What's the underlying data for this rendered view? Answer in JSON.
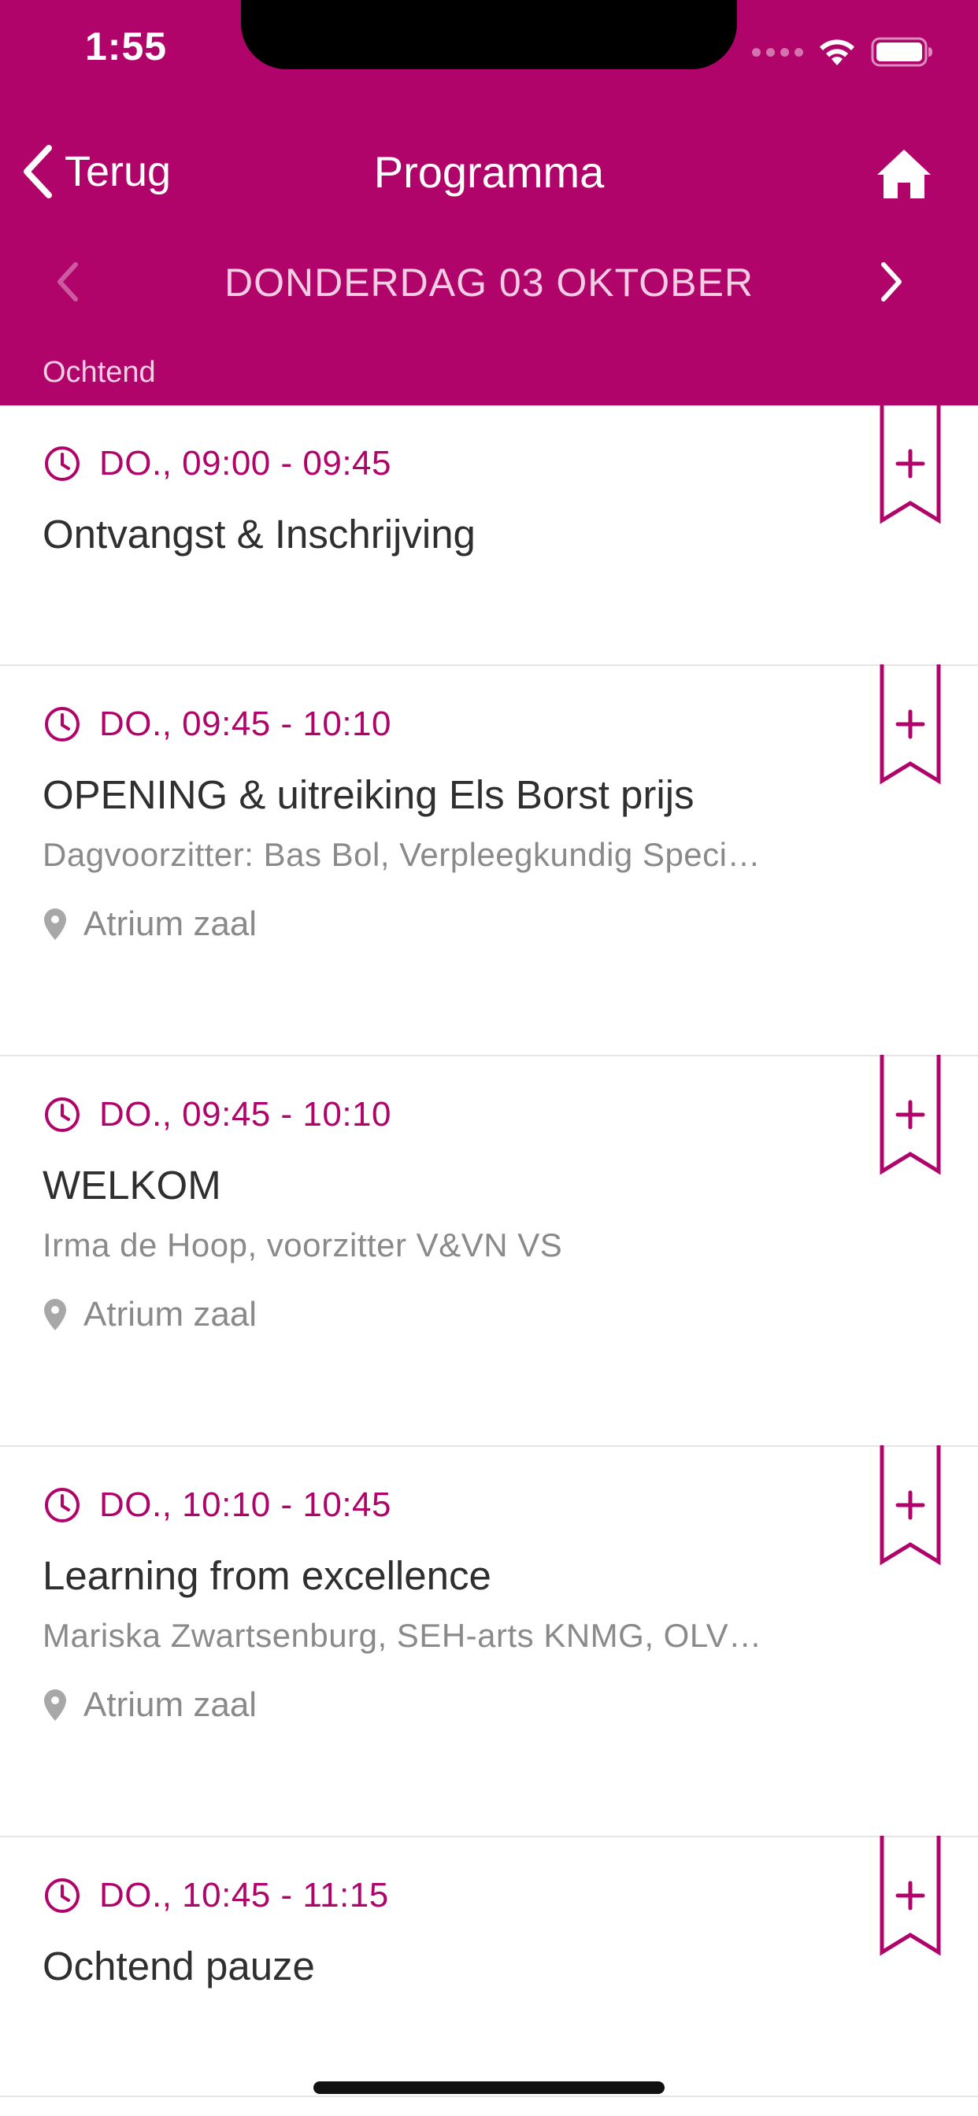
{
  "status_bar": {
    "time": "1:55"
  },
  "nav": {
    "back_label": "Terug",
    "title": "Programma",
    "home_icon": "home-icon"
  },
  "date_bar": {
    "label": "DONDERDAG 03 OKTOBER",
    "prev_enabled": false,
    "next_enabled": true
  },
  "section": {
    "label": "Ochtend"
  },
  "colors": {
    "accent": "#b0046b",
    "muted_text": "#8a8a8a",
    "title_text": "#2f2f2f"
  },
  "items": [
    {
      "time": "DO., 09:00 - 09:45",
      "title": "Ontvangst & Inschrijving"
    },
    {
      "time": "DO., 09:45 - 10:10",
      "title": "OPENING & uitreiking Els Borst prijs",
      "subtitle": "Dagvoorzitter: Bas Bol, Verpleegkundig Speci…",
      "location": "Atrium zaal"
    },
    {
      "time": "DO., 09:45 - 10:10",
      "title": "WELKOM",
      "subtitle": "Irma de Hoop, voorzitter V&VN VS",
      "location": "Atrium zaal"
    },
    {
      "time": "DO., 10:10 - 10:45",
      "title": "Learning from excellence",
      "subtitle": "Mariska Zwartsenburg, SEH-arts KNMG, OLV…",
      "location": "Atrium zaal"
    },
    {
      "time": "DO., 10:45 - 11:15",
      "title": "Ochtend pauze"
    }
  ]
}
